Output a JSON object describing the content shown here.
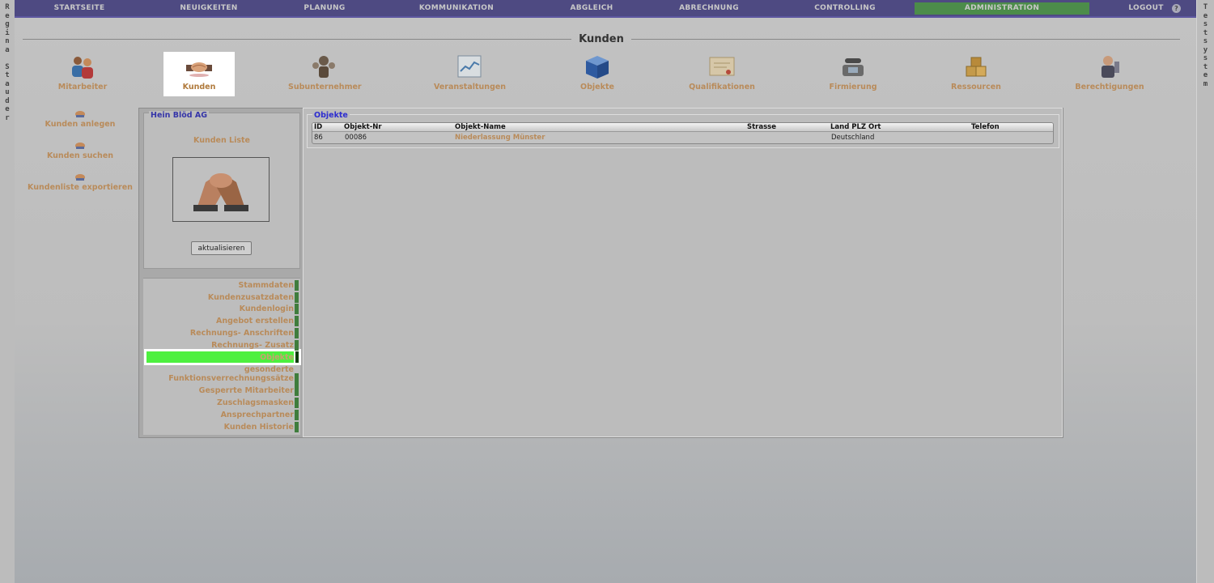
{
  "side_left": [
    "R",
    "e",
    "g",
    "i",
    "n",
    "a",
    "",
    "S",
    "t",
    "a",
    "u",
    "d",
    "e",
    "r"
  ],
  "side_right": [
    "T",
    "e",
    "s",
    "t",
    "s",
    "y",
    "s",
    "t",
    "e",
    "m"
  ],
  "nav": {
    "items": [
      "STARTSEITE",
      "NEUIGKEITEN",
      "PLANUNG",
      "KOMMUNIKATION",
      "ABGLEICH",
      "ABRECHNUNG",
      "CONTROLLING",
      "ADMINISTRATION",
      "LOGOUT"
    ],
    "active": "ADMINISTRATION",
    "help_icon": "help-icon",
    "active_color": "#4c8c4a"
  },
  "page_title": "Kunden",
  "modules": [
    {
      "label": "Mitarbeiter",
      "icon": "people-icon"
    },
    {
      "label": "Kunden",
      "icon": "handshake-icon"
    },
    {
      "label": "Subunternehmer",
      "icon": "subcontractor-icon"
    },
    {
      "label": "Veranstaltungen",
      "icon": "calendar-chart-icon"
    },
    {
      "label": "Objekte",
      "icon": "cube-icon"
    },
    {
      "label": "Qualifikationen",
      "icon": "certificate-icon"
    },
    {
      "label": "Firmierung",
      "icon": "telephone-icon"
    },
    {
      "label": "Ressourcen",
      "icon": "boxes-icon"
    },
    {
      "label": "Berechtigungen",
      "icon": "security-person-icon"
    }
  ],
  "selected_module": "Kunden",
  "actions": [
    "Kunden anlegen",
    "Kunden suchen",
    "Kundenliste exportieren"
  ],
  "customer": {
    "name": "Hein Blöd AG",
    "list_label": "Kunden Liste",
    "refresh_button": "aktualisieren"
  },
  "tabs": [
    "Stammdaten",
    "Kundenzusatzdaten",
    "Kundenlogin",
    "Angebot erstellen",
    "Rechnungs- Anschriften",
    "Rechnungs- Zusatz",
    "Objekte",
    "gesonderte",
    "Funktionsverrechnungssätze",
    "Gesperrte Mitarbeiter",
    "Zuschlagsmasken",
    "Ansprechpartner",
    "Kunden Historie"
  ],
  "active_tab": "Objekte",
  "objekte": {
    "legend": "Objekte",
    "columns": [
      "ID",
      "Objekt-Nr",
      "Objekt-Name",
      "Strasse",
      "Land PLZ Ort",
      "Telefon"
    ],
    "rows": [
      {
        "id": "86",
        "nr": "00086",
        "name": "Niederlassung Münster",
        "strasse": "",
        "ort": "Deutschland",
        "telefon": ""
      }
    ]
  }
}
